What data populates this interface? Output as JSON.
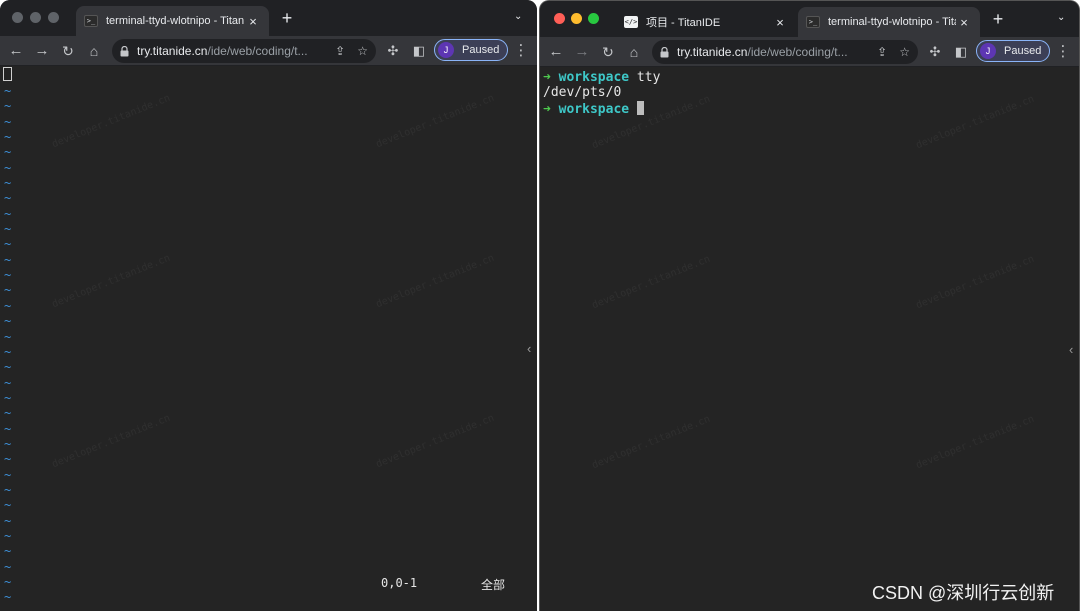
{
  "left_window": {
    "tab_title": "terminal-ttyd-wlotnipo - TitanIDE",
    "tab_close": "×",
    "new_tab": "+",
    "tab_menu": "⌄",
    "url_host": "try.titanide.cn",
    "url_path": "/ide/web/coding/t...",
    "profile_initial": "J",
    "profile_label": "Paused",
    "tilde_char": "~",
    "tilde_count": 34,
    "vim_position": "0,0-1",
    "vim_scroll": "全部"
  },
  "right_window": {
    "tabs": [
      {
        "title": "项目 - TitanIDE",
        "icon": "code-brackets-icon",
        "close": "×"
      },
      {
        "title": "terminal-ttyd-wlotnipo - TitanIDE",
        "icon": "terminal-icon",
        "close": "×"
      }
    ],
    "new_tab": "+",
    "tab_menu": "⌄",
    "url_host": "try.titanide.cn",
    "url_path": "/ide/web/coding/t...",
    "profile_initial": "J",
    "profile_label": "Paused",
    "terminal": {
      "line1_arrow": "➜",
      "line1_dir": "workspace",
      "line1_cmd": " tty",
      "line2_output": "/dev/pts/0",
      "line3_arrow": "➜",
      "line3_dir": "workspace"
    }
  },
  "watermark_text": "developer.titanide.cn",
  "csdn_watermark": "CSDN @深圳行云创新",
  "colors": {
    "tab_strip": "#202124",
    "toolbar": "#35363a",
    "terminal_bg": "#242424",
    "prompt_arrow": "#4ec94e",
    "prompt_dir": "#3ec8c8",
    "vim_tilde": "#3d8fd6",
    "profile_border": "#8ab4f8"
  }
}
